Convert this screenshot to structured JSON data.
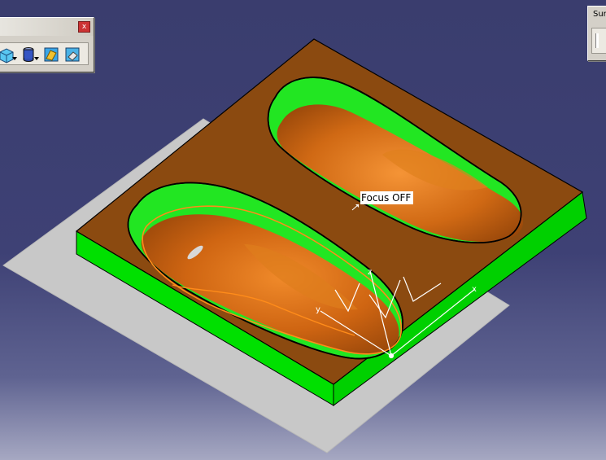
{
  "viewport": {
    "background_top": "#3a3d6e",
    "background_bottom": "#a6a8c2"
  },
  "toolbars": {
    "left": {
      "close_glyph": "x",
      "icons": [
        "view-box-icon",
        "cylinder-icon",
        "apply-material-icon",
        "eraser-icon"
      ]
    },
    "right": {
      "title": "Sur"
    }
  },
  "tooltip": {
    "text": "Focus OFF"
  },
  "axes": {
    "x_label": "x",
    "y_label": "y",
    "z_label": "z"
  },
  "colors": {
    "mold_top": "#8b4a10",
    "mold_wall": "#00e000",
    "cavity_surface": "#d16a12",
    "ground_plane": "#c8c8c8",
    "selection_outline": "#ff8c1a"
  }
}
